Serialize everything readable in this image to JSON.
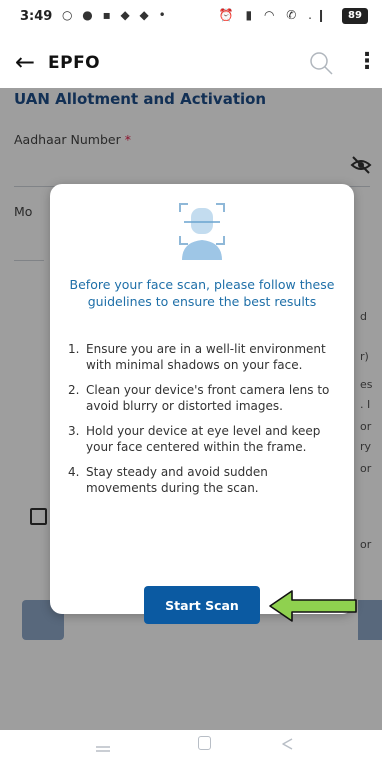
{
  "status_bar": {
    "time": "3:49",
    "left_icons": "○ ● ▪ ◆ ◆ •",
    "right_icons": "⏰ ▮ ◠ ✆ .❙",
    "battery": "89"
  },
  "app_bar": {
    "back_icon": "←",
    "title": "EPFO",
    "menu_icon": "⋮"
  },
  "form": {
    "heading": "UAN Allotment and Activation",
    "aadhaar_label": "Aadhaar Number",
    "required_marker": "*",
    "mobile_label_partial": "Mo",
    "right_edge_fragments": [
      "d",
      "r)",
      "es",
      ". I",
      "or",
      "ry",
      "or",
      "or"
    ]
  },
  "modal": {
    "title": "Before your face scan, please follow these guidelines to ensure the best results",
    "guidelines": [
      {
        "num": "1.",
        "text": "Ensure you are in a well-lit environment with minimal shadows on your face."
      },
      {
        "num": "2.",
        "text": "Clean your device's front camera lens to avoid blurry or distorted images."
      },
      {
        "num": "3.",
        "text": "Hold your device at eye level and keep your face centered within the frame."
      },
      {
        "num": "4.",
        "text": "Stay steady and avoid sudden movements during the scan."
      }
    ],
    "start_button": "Start Scan"
  },
  "colors": {
    "accent": "#0b5aa2",
    "title_text": "#1e6fa8",
    "heading": "#1d4e89",
    "arrow_fill": "#8fd14f",
    "required": "#e11d48"
  },
  "icons": {
    "search": "search-icon",
    "eye_off": "eye-off-icon",
    "face": "face-scan-icon",
    "arrow": "arrow-left-icon"
  }
}
